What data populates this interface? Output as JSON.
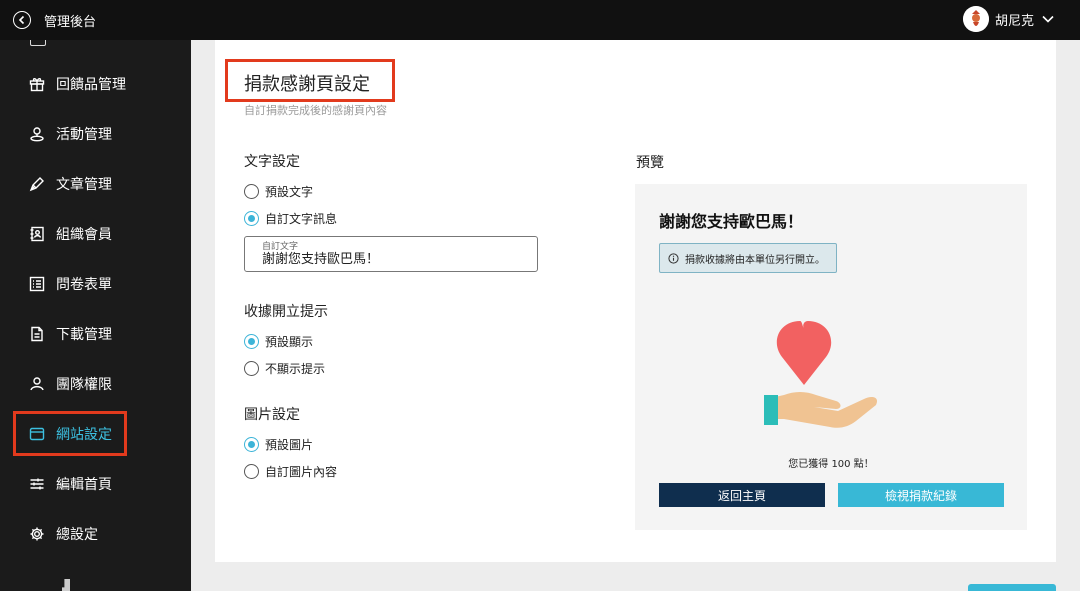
{
  "header": {
    "title": "管理後台",
    "user_name": "胡尼克"
  },
  "sidebar": {
    "items": [
      {
        "label": "回饋品管理",
        "icon": "gift-icon"
      },
      {
        "label": "活動管理",
        "icon": "location-pin-icon"
      },
      {
        "label": "文章管理",
        "icon": "pen-icon"
      },
      {
        "label": "組織會員",
        "icon": "address-book-icon"
      },
      {
        "label": "問卷表單",
        "icon": "list-icon"
      },
      {
        "label": "下載管理",
        "icon": "document-icon"
      },
      {
        "label": "團隊權限",
        "icon": "user-icon"
      },
      {
        "label": "網站設定",
        "icon": "browser-window-icon",
        "active": true
      },
      {
        "label": "編輯首頁",
        "icon": "sliders-icon"
      },
      {
        "label": "總設定",
        "icon": "gear-icon"
      }
    ]
  },
  "page": {
    "title": "捐款感謝頁設定",
    "subtitle": "自訂捐款完成後的感謝頁內容"
  },
  "text_settings": {
    "title": "文字設定",
    "options": [
      {
        "label": "預設文字",
        "checked": false
      },
      {
        "label": "自訂文字訊息",
        "checked": true
      }
    ],
    "input_label": "自訂文字",
    "input_value": "謝謝您支持歐巴馬！"
  },
  "receipt_settings": {
    "title": "收據開立提示",
    "options": [
      {
        "label": "預設顯示",
        "checked": true
      },
      {
        "label": "不顯示提示",
        "checked": false
      }
    ]
  },
  "image_settings": {
    "title": "圖片設定",
    "options": [
      {
        "label": "預設圖片",
        "checked": true
      },
      {
        "label": "自訂圖片內容",
        "checked": false
      }
    ]
  },
  "preview": {
    "title": "預覽",
    "message": "謝謝您支持歐巴馬！",
    "receipt_note": "捐款收據將由本單位另行開立。",
    "points_text": "您已獲得 100 點！",
    "home_button": "返回主頁",
    "records_button": "檢視捐款紀錄"
  },
  "colors": {
    "accent": "#38b8d6",
    "highlight_border": "#e23a1d",
    "dark_button": "#0f2e4e",
    "sidebar_bg": "#1b1b1b"
  }
}
